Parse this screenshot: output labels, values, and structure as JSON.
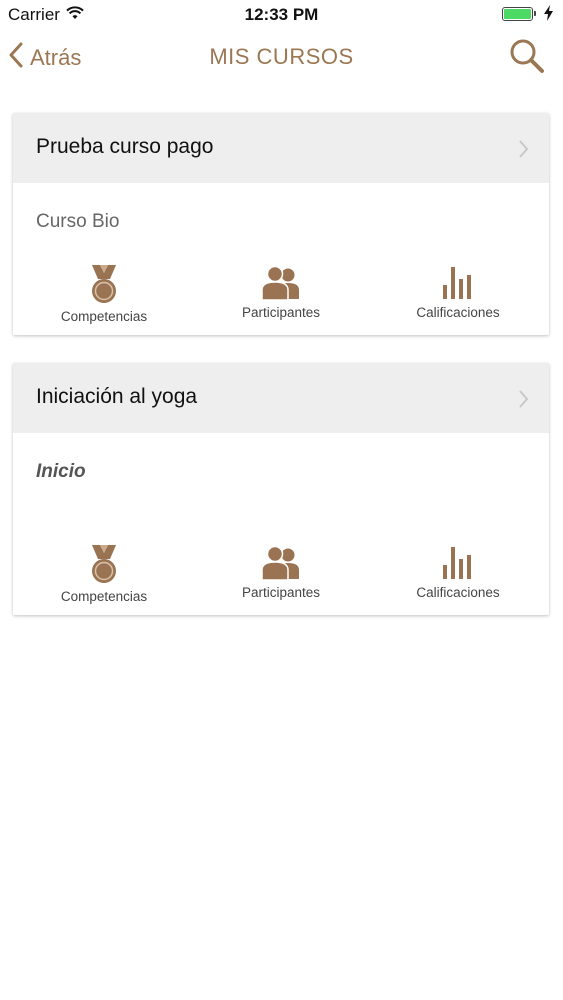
{
  "status": {
    "carrier": "Carrier",
    "time": "12:33 PM"
  },
  "nav": {
    "back_label": "Atrás",
    "title": "MIS CURSOS"
  },
  "colors": {
    "accent": "#9b7753",
    "icon": "#9a7352",
    "header_bg": "#efeeee"
  },
  "courses": [
    {
      "title": "Prueba curso pago",
      "subtitle": "Curso Bio",
      "subtitle_style": "normal",
      "actions": [
        "Competencias",
        "Participantes",
        "Calificaciones"
      ]
    },
    {
      "title": "Iniciación al yoga",
      "subtitle": "Inicio",
      "subtitle_style": "italic",
      "actions": [
        "Competencias",
        "Participantes",
        "Calificaciones"
      ]
    }
  ]
}
